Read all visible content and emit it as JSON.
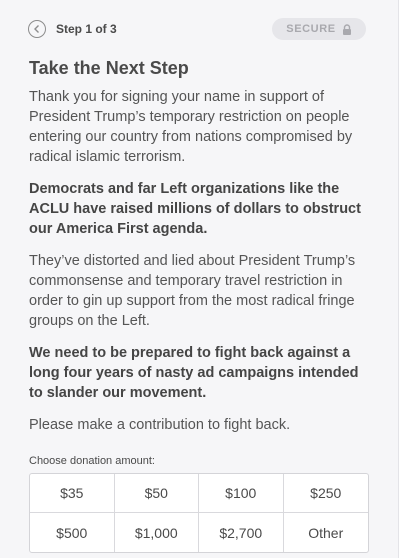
{
  "header": {
    "step_label": "Step 1 of 3",
    "secure_label": "SECURE",
    "back_icon": "chevron-left-circle-icon",
    "lock_icon": "lock-icon"
  },
  "main": {
    "title": "Take the Next Step",
    "paragraphs": [
      "Thank you for signing your name in support of President Trump’s temporary restriction on people entering our country from nations compromised by radical islamic terrorism.",
      "Democrats and far Left organizations like the ACLU have raised millions of dollars to obstruct our America First agenda.",
      "They’ve distorted and lied about President Trump’s commonsense and temporary travel restriction in order to gin up support from the most radical fringe groups on the Left.",
      "We need to be prepared to fight back against a long four years of nasty ad campaigns intended to slander our movement.",
      "Please make a contribution to fight back."
    ]
  },
  "donation": {
    "label": "Choose donation amount:",
    "amounts": [
      "$35",
      "$50",
      "$100",
      "$250",
      "$500",
      "$1,000",
      "$2,700",
      "Other"
    ]
  },
  "colors": {
    "panel_bg": "#f6f6f8",
    "text": "#4a4a4a",
    "badge_bg": "#e6e6ea",
    "badge_text": "#a9a9ae"
  }
}
